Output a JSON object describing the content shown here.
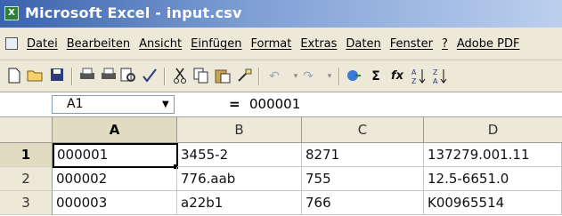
{
  "window": {
    "title": "Microsoft Excel - input.csv",
    "app_icon_glyph": "X"
  },
  "menu": [
    "Datei",
    "Bearbeiten",
    "Ansicht",
    "Einfügen",
    "Format",
    "Extras",
    "Daten",
    "Fenster",
    "?",
    "Adobe PDF"
  ],
  "toolbar": {
    "icons": [
      "new-icon",
      "open-icon",
      "save-icon",
      "print-icon",
      "print-preview-icon",
      "preview-icon",
      "spellcheck-icon",
      "cut-icon",
      "copy-icon",
      "paste-icon",
      "format-painter-icon",
      "undo-icon",
      "redo-icon",
      "hyperlink-icon",
      "autosum-icon",
      "function-icon",
      "sort-ascending-icon",
      "sort-descending-icon"
    ],
    "glyphs": {
      "autosum": "Σ",
      "function": "fx"
    }
  },
  "formula_bar": {
    "cell_ref": "A1",
    "equals": "=",
    "value": "000001"
  },
  "grid": {
    "columns": [
      "A",
      "B",
      "C",
      "D"
    ],
    "rows": [
      {
        "num": "1",
        "cells": [
          "000001",
          "3455-2",
          "8271",
          "137279.001.11"
        ]
      },
      {
        "num": "2",
        "cells": [
          "000002",
          "776.aab",
          "755",
          "12.5-6651.0"
        ]
      },
      {
        "num": "3",
        "cells": [
          "000003",
          "a22b1",
          "766",
          "K00965514"
        ]
      }
    ]
  },
  "colors": {
    "title_gradient_start": "#3a63ad",
    "chrome": "#ece9d8",
    "active_header": "#e1dcc1"
  }
}
